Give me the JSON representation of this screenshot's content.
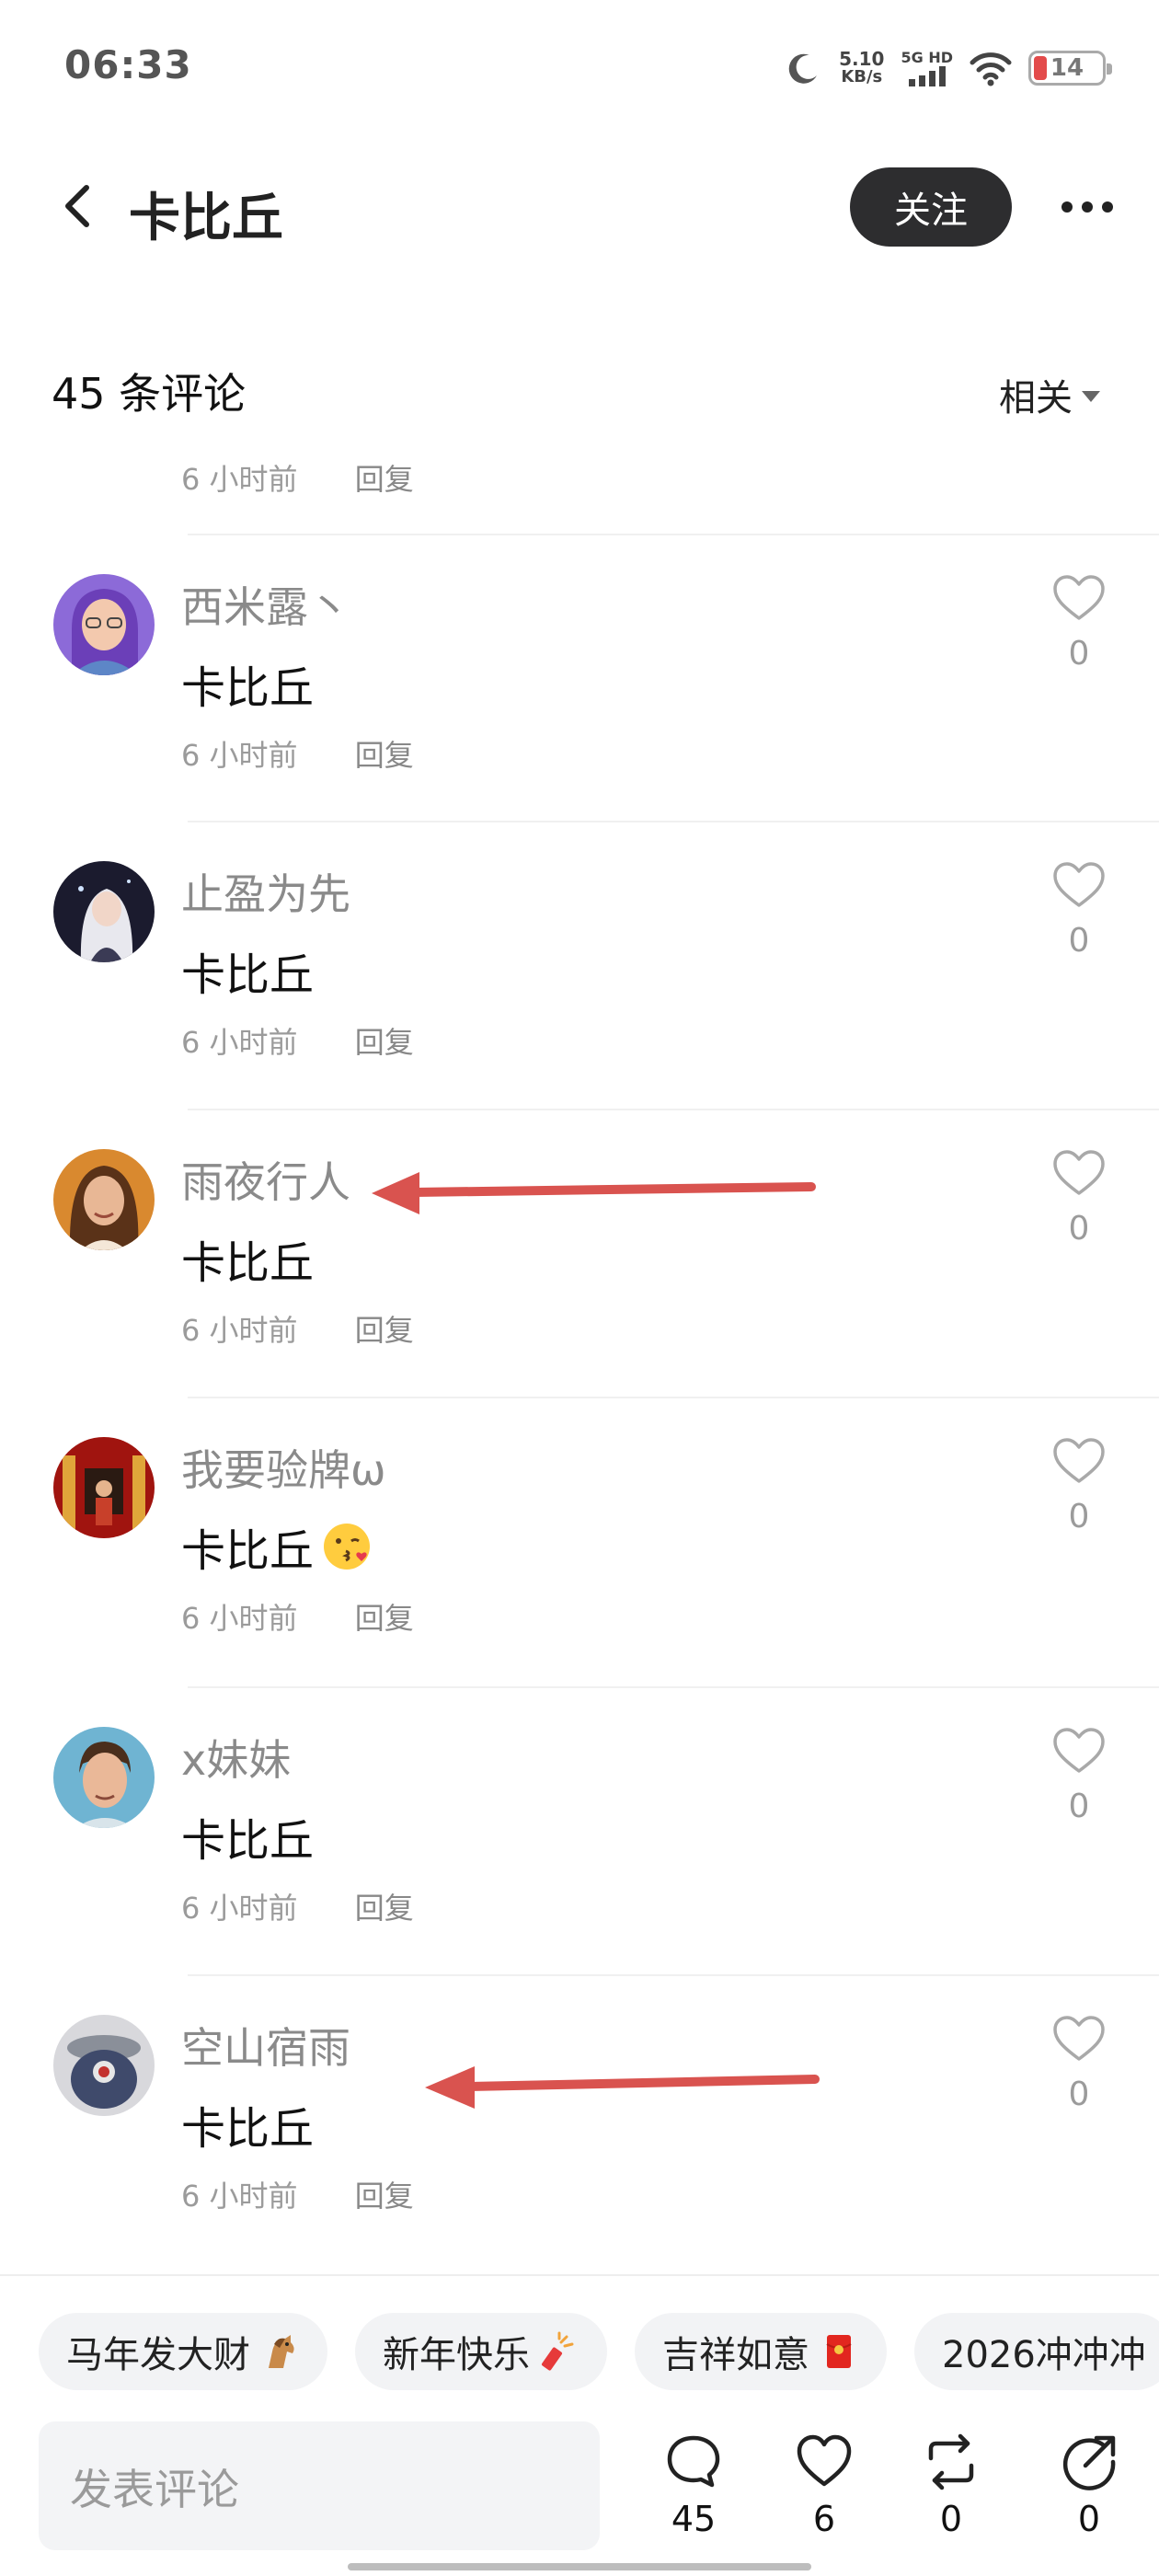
{
  "status_bar": {
    "time": "06:33",
    "net_speed": "5.10",
    "net_unit": "KB/s",
    "signal_label": "5G HD",
    "battery": "14"
  },
  "header": {
    "title": "卡比丘",
    "follow_label": "关注"
  },
  "comments_section": {
    "count_label": "45 条评论",
    "sort_label": "相关",
    "partial_item": {
      "time": "6 小时前",
      "reply": "回复"
    },
    "items": [
      {
        "user": "西米露丶",
        "text": "卡比丘",
        "time": "6 小时前",
        "reply": "回复",
        "likes": "0",
        "avatar_color": "#8c6ad8"
      },
      {
        "user": "止盈为先",
        "text": "卡比丘",
        "time": "6 小时前",
        "reply": "回复",
        "likes": "0",
        "avatar_color": "#1b1b2e"
      },
      {
        "user": "雨夜行人",
        "text": "卡比丘",
        "time": "6 小时前",
        "reply": "回复",
        "likes": "0",
        "avatar_color": "#d9892f"
      },
      {
        "user": "我要验牌ω",
        "text": "卡比丘",
        "time": "6 小时前",
        "reply": "回复",
        "likes": "0",
        "avatar_color": "#a0140f",
        "emoji": "kiss-face-emoji"
      },
      {
        "user": "x妹妹",
        "text": "卡比丘",
        "time": "6 小时前",
        "reply": "回复",
        "likes": "0",
        "avatar_color": "#6fb4d2"
      },
      {
        "user": "空山宿雨",
        "text": "卡比丘",
        "time": "6 小时前",
        "reply": "回复",
        "likes": "0",
        "avatar_color": "#6a6f7a"
      }
    ]
  },
  "quick_chips": [
    {
      "label": "马年发大财",
      "icon": "horse-icon"
    },
    {
      "label": "新年快乐",
      "icon": "firecracker-icon"
    },
    {
      "label": "吉祥如意",
      "icon": "red-envelope-icon"
    },
    {
      "label": "2026冲冲冲",
      "icon": ""
    }
  ],
  "bottom_bar": {
    "input_placeholder": "发表评论",
    "comments": "45",
    "likes": "6",
    "reposts": "0",
    "shares": "0"
  },
  "colors": {
    "annotation_arrow": "#d9534f",
    "follow_button": "#2d2d2f"
  }
}
